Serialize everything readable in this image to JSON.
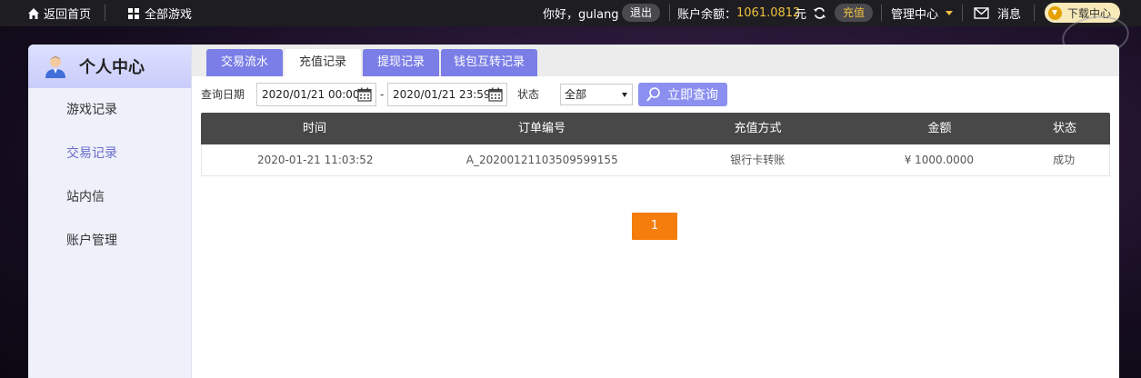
{
  "topbar": {
    "home_label": "返回首页",
    "games_label": "全部游戏",
    "greeting": "你好，gulang",
    "logout_label": "退出",
    "balance_label": "账户余额：",
    "balance_value": "1061.0812",
    "currency": "元",
    "recharge_label": "充值",
    "management_label": "管理中心",
    "messages_label": "消息",
    "download_label": "下载中心"
  },
  "sidebar": {
    "title": "个人中心",
    "items": [
      {
        "label": "游戏记录",
        "active": false
      },
      {
        "label": "交易记录",
        "active": true
      },
      {
        "label": "站内信",
        "active": false
      },
      {
        "label": "账户管理",
        "active": false
      }
    ]
  },
  "tabs": [
    {
      "label": "交易流水",
      "active": false
    },
    {
      "label": "充值记录",
      "active": true
    },
    {
      "label": "提现记录",
      "active": false
    },
    {
      "label": "钱包互转记录",
      "active": false
    }
  ],
  "filter": {
    "date_label": "查询日期",
    "start_date": "2020/01/21 00:00",
    "date_separator": "-",
    "end_date": "2020/01/21 23:59",
    "status_label": "状态",
    "status_value": "全部",
    "search_label": "立即查询"
  },
  "table": {
    "columns": [
      "时间",
      "订单编号",
      "充值方式",
      "金额",
      "状态"
    ],
    "rows": [
      [
        "2020-01-21 11:03:52",
        "A_20200121103509599155",
        "银行卡转账",
        "¥ 1000.0000",
        "成功"
      ]
    ]
  },
  "pagination": {
    "current_page": "1"
  },
  "colors": {
    "accent": "#7a7ee6",
    "balance": "#f0c040",
    "pager": "#f47d0c",
    "table_header": "#484848"
  },
  "icons": {
    "home": "home-icon",
    "games": "grid-icon",
    "refresh": "refresh-icon",
    "dropdown": "chevron-down-icon",
    "messages": "envelope-icon",
    "download": "download-icon",
    "calendar": "calendar-icon",
    "search": "magnifier-icon",
    "avatar": "user-avatar-icon"
  }
}
